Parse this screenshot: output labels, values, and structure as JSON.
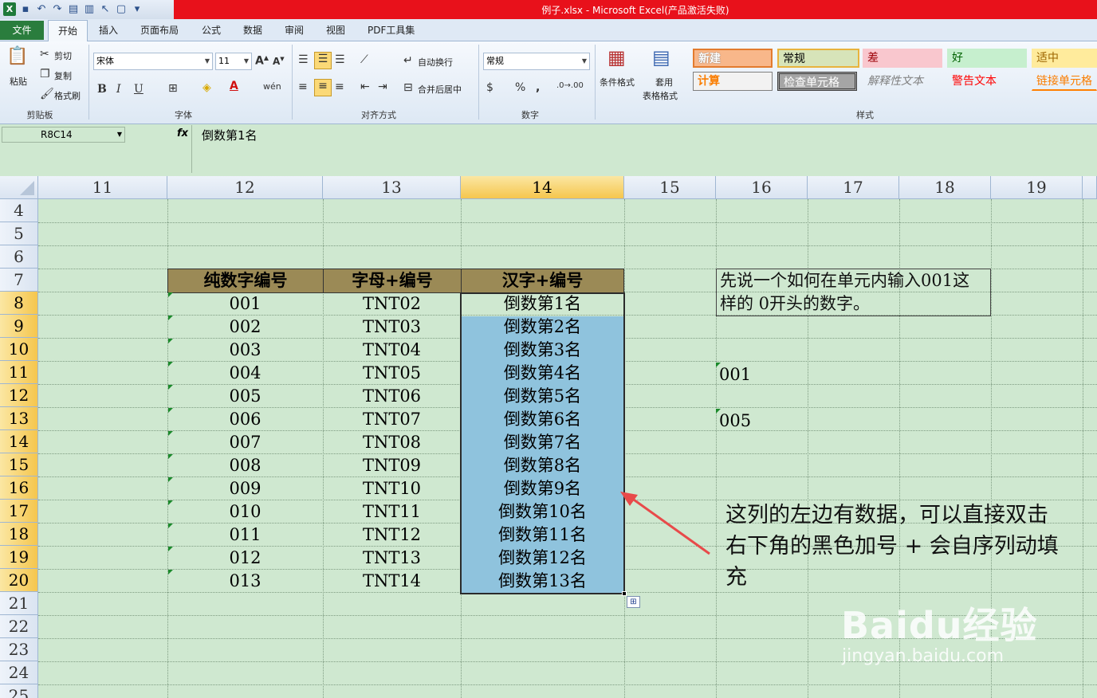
{
  "titlebar": {
    "title": "例子.xlsx -  Microsoft Excel(产品激活失败)"
  },
  "tabs": [
    "文件",
    "开始",
    "插入",
    "页面布局",
    "公式",
    "数据",
    "审阅",
    "视图",
    "PDF工具集"
  ],
  "ribbon": {
    "clipboard": {
      "paste": "粘贴",
      "cut": "剪切",
      "copy": "复制",
      "format_painter": "格式刷",
      "group": "剪贴板"
    },
    "font": {
      "name": "宋体",
      "size": "11",
      "group": "字体"
    },
    "alignment": {
      "wrap": "自动换行",
      "merge": "合并后居中",
      "group": "对齐方式"
    },
    "number": {
      "format": "常规",
      "group": "数字"
    },
    "cond_format": "条件格式",
    "table_format_1": "套用",
    "table_format_2": "表格格式",
    "styles": {
      "group": "样式",
      "items": [
        "新建",
        "常规",
        "差",
        "好",
        "适中",
        "计算",
        "检查单元格",
        "解释性文本",
        "警告文本",
        "链接单元格"
      ]
    }
  },
  "formula_bar": {
    "name_box": "R8C14",
    "fx": "fx",
    "content": "倒数第1名"
  },
  "columns": [
    "11",
    "12",
    "13",
    "14",
    "15",
    "16",
    "17",
    "18",
    "19"
  ],
  "rows": [
    "4",
    "5",
    "6",
    "7",
    "8",
    "9",
    "10",
    "11",
    "12",
    "13",
    "14",
    "15",
    "16",
    "17",
    "18",
    "19",
    "20",
    "21",
    "22",
    "23",
    "24",
    "25"
  ],
  "table": {
    "headers": [
      "纯数字编号",
      "字母+编号",
      "汉字+编号"
    ],
    "rows": [
      [
        "001",
        "TNT02",
        "倒数第1名"
      ],
      [
        "002",
        "TNT03",
        "倒数第2名"
      ],
      [
        "003",
        "TNT04",
        "倒数第3名"
      ],
      [
        "004",
        "TNT05",
        "倒数第4名"
      ],
      [
        "005",
        "TNT06",
        "倒数第5名"
      ],
      [
        "006",
        "TNT07",
        "倒数第6名"
      ],
      [
        "007",
        "TNT08",
        "倒数第7名"
      ],
      [
        "008",
        "TNT09",
        "倒数第8名"
      ],
      [
        "009",
        "TNT10",
        "倒数第9名"
      ],
      [
        "010",
        "TNT11",
        "倒数第10名"
      ],
      [
        "011",
        "TNT12",
        "倒数第11名"
      ],
      [
        "012",
        "TNT13",
        "倒数第12名"
      ],
      [
        "013",
        "TNT14",
        "倒数第13名"
      ]
    ]
  },
  "note": {
    "line1": "先说一个如何在单元内输入001这",
    "line2": "样的 0开头的数字。"
  },
  "side_values": [
    "001",
    "005"
  ],
  "annotation": {
    "line1": "这列的左边有数据，可以直接双击",
    "line2": "右下角的黑色加号 + 会自序列动填",
    "line3": "充"
  },
  "watermark": {
    "logo": "Baidu经验",
    "url": "jingyan.baidu.com"
  },
  "colors": {
    "selection_fill": "#8fc3dd",
    "header_fill": "#9b8a56",
    "sheet_bg": "#cfe8d0",
    "arrow": "#e84a4a",
    "title_red": "#e8111b"
  }
}
